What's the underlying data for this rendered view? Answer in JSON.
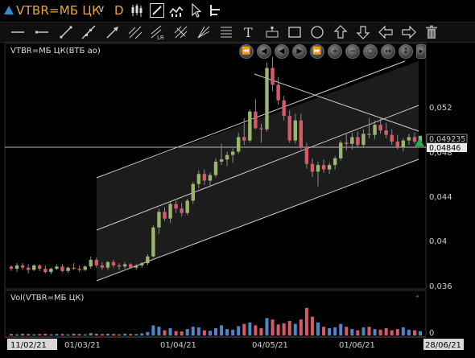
{
  "header": {
    "symbol": "VTBR=МБ ЦК",
    "interval": "D",
    "colors": {
      "symbol": "#e8a63a",
      "accent": "#2f8bd6"
    }
  },
  "toolbar_icons": [
    "candles-icon",
    "draw-icon",
    "indicator-icon",
    "cursor-icon",
    "tree-icon"
  ],
  "draw_tools": [
    "line-icon",
    "ray-icon",
    "segment-icon",
    "arrow-icon",
    "fib-icon",
    "lr-channel-icon",
    "pitchfork-icon",
    "gann-icon",
    "text-icon",
    "price-label-icon",
    "rectangle-icon",
    "circle-icon",
    "arrow-up-icon",
    "arrow-down-icon",
    "arrow-left-icon",
    "arrow-right-icon",
    "trash-icon"
  ],
  "price_pane": {
    "title": "VTBR=МБ ЦК(ВТБ ао)",
    "y_ticks": [
      "0,052",
      "0,048",
      "0,044",
      "0,04",
      "0,036"
    ],
    "last_price": "0,049235",
    "cursor_price": "0,04846"
  },
  "volume_pane": {
    "title": "Vol(VTBR=МБ ЦК)",
    "y_ticks": [
      "0"
    ]
  },
  "x_axis": {
    "start_date": "11/02/21",
    "end_date": "28/06/21",
    "ticks": [
      "01/03/21",
      "01/04/21",
      "04/05/21",
      "01/06/21"
    ]
  },
  "chart_data": {
    "type": "candlestick",
    "ylim": [
      0.0355,
      0.0575
    ],
    "candles": [
      [
        0.0375,
        0.0376,
        0.0371,
        0.0373
      ],
      [
        0.0373,
        0.0378,
        0.037,
        0.0376
      ],
      [
        0.0376,
        0.0378,
        0.0372,
        0.0374
      ],
      [
        0.0374,
        0.0377,
        0.0369,
        0.0372
      ],
      [
        0.0372,
        0.0377,
        0.0371,
        0.0376
      ],
      [
        0.0376,
        0.0377,
        0.0371,
        0.0373
      ],
      [
        0.0373,
        0.0376,
        0.0369,
        0.037
      ],
      [
        0.037,
        0.0374,
        0.0368,
        0.0373
      ],
      [
        0.0373,
        0.0377,
        0.0372,
        0.0375
      ],
      [
        0.0375,
        0.0377,
        0.037,
        0.0371
      ],
      [
        0.0371,
        0.0375,
        0.0369,
        0.0374
      ],
      [
        0.0374,
        0.0378,
        0.0372,
        0.0373
      ],
      [
        0.0373,
        0.0376,
        0.037,
        0.0372
      ],
      [
        0.0372,
        0.0376,
        0.0371,
        0.0375
      ],
      [
        0.0375,
        0.0384,
        0.0373,
        0.0381
      ],
      [
        0.0381,
        0.0383,
        0.0374,
        0.0376
      ],
      [
        0.0376,
        0.0379,
        0.0372,
        0.0374
      ],
      [
        0.0374,
        0.038,
        0.0372,
        0.0379
      ],
      [
        0.0379,
        0.0381,
        0.0374,
        0.0376
      ],
      [
        0.0376,
        0.0378,
        0.0372,
        0.0375
      ],
      [
        0.0375,
        0.0379,
        0.0373,
        0.0377
      ],
      [
        0.0377,
        0.0378,
        0.0373,
        0.0374
      ],
      [
        0.0374,
        0.0377,
        0.0372,
        0.0376
      ],
      [
        0.0376,
        0.0379,
        0.0374,
        0.0378
      ],
      [
        0.0378,
        0.0386,
        0.0376,
        0.0384
      ],
      [
        0.0384,
        0.0412,
        0.0383,
        0.041
      ],
      [
        0.041,
        0.0427,
        0.0404,
        0.0424
      ],
      [
        0.0424,
        0.0428,
        0.0416,
        0.0418
      ],
      [
        0.0418,
        0.0433,
        0.0414,
        0.0431
      ],
      [
        0.0431,
        0.0434,
        0.0423,
        0.0427
      ],
      [
        0.0427,
        0.0432,
        0.042,
        0.0423
      ],
      [
        0.0423,
        0.0436,
        0.0421,
        0.0434
      ],
      [
        0.0434,
        0.0451,
        0.0431,
        0.0449
      ],
      [
        0.0449,
        0.0461,
        0.0445,
        0.0458
      ],
      [
        0.0458,
        0.0462,
        0.0448,
        0.0452
      ],
      [
        0.0452,
        0.0459,
        0.0446,
        0.0457
      ],
      [
        0.0457,
        0.0472,
        0.0455,
        0.0469
      ],
      [
        0.0469,
        0.0485,
        0.0466,
        0.0471
      ],
      [
        0.0471,
        0.0478,
        0.0465,
        0.0475
      ],
      [
        0.0475,
        0.0481,
        0.0468,
        0.0478
      ],
      [
        0.0478,
        0.0495,
        0.0476,
        0.0491
      ],
      [
        0.0491,
        0.0508,
        0.0484,
        0.0488
      ],
      [
        0.0488,
        0.0516,
        0.0486,
        0.0514
      ],
      [
        0.0514,
        0.0525,
        0.0498,
        0.0499
      ],
      [
        0.0499,
        0.0503,
        0.0486,
        0.0498
      ],
      [
        0.0498,
        0.0558,
        0.0496,
        0.0553
      ],
      [
        0.0553,
        0.0563,
        0.0532,
        0.0538
      ],
      [
        0.0538,
        0.0545,
        0.052,
        0.0524
      ],
      [
        0.0524,
        0.0528,
        0.0506,
        0.051
      ],
      [
        0.051,
        0.0515,
        0.0486,
        0.0488
      ],
      [
        0.0488,
        0.0512,
        0.0485,
        0.0506
      ],
      [
        0.0506,
        0.0512,
        0.048,
        0.0482
      ],
      [
        0.0482,
        0.0486,
        0.0463,
        0.0467
      ],
      [
        0.0467,
        0.0472,
        0.0455,
        0.046
      ],
      [
        0.046,
        0.0469,
        0.0447,
        0.0466
      ],
      [
        0.0466,
        0.0471,
        0.0459,
        0.0462
      ],
      [
        0.0462,
        0.0468,
        0.0458,
        0.0466
      ],
      [
        0.0466,
        0.0474,
        0.0462,
        0.0472
      ],
      [
        0.0472,
        0.0488,
        0.047,
        0.0486
      ],
      [
        0.0486,
        0.0494,
        0.0479,
        0.0485
      ],
      [
        0.0485,
        0.0495,
        0.048,
        0.0491
      ],
      [
        0.0491,
        0.0496,
        0.0481,
        0.0484
      ],
      [
        0.0484,
        0.0498,
        0.0481,
        0.0494
      ],
      [
        0.0494,
        0.0508,
        0.049,
        0.0493
      ],
      [
        0.0493,
        0.0506,
        0.0489,
        0.0502
      ],
      [
        0.0502,
        0.0509,
        0.0494,
        0.0497
      ],
      [
        0.0497,
        0.0504,
        0.049,
        0.0493
      ],
      [
        0.0493,
        0.0498,
        0.0484,
        0.0487
      ],
      [
        0.0487,
        0.0493,
        0.048,
        0.0482
      ],
      [
        0.0482,
        0.049,
        0.0478,
        0.0488
      ],
      [
        0.0488,
        0.0494,
        0.0484,
        0.0491
      ],
      [
        0.0491,
        0.0495,
        0.0485,
        0.0487
      ],
      [
        0.0487,
        0.0493,
        0.0484,
        0.0492
      ]
    ],
    "volume_relative": [
      0.05,
      0.04,
      0.06,
      0.05,
      0.04,
      0.05,
      0.06,
      0.04,
      0.05,
      0.05,
      0.04,
      0.06,
      0.05,
      0.04,
      0.08,
      0.06,
      0.05,
      0.06,
      0.05,
      0.04,
      0.06,
      0.05,
      0.05,
      0.07,
      0.12,
      0.35,
      0.3,
      0.18,
      0.25,
      0.15,
      0.14,
      0.22,
      0.3,
      0.28,
      0.18,
      0.16,
      0.25,
      0.35,
      0.22,
      0.2,
      0.32,
      0.4,
      0.45,
      0.35,
      0.25,
      0.6,
      0.55,
      0.38,
      0.42,
      0.5,
      0.4,
      0.55,
      0.95,
      0.65,
      0.45,
      0.3,
      0.25,
      0.28,
      0.4,
      0.3,
      0.22,
      0.18,
      0.28,
      0.3,
      0.22,
      0.2,
      0.25,
      0.18,
      0.22,
      0.28,
      0.2,
      0.18,
      0.15
    ],
    "colors": {
      "up": "#9bb56a",
      "down": "#d85a6a",
      "volume_up": "#4f86c9",
      "volume_down": "#d85a6a"
    }
  }
}
